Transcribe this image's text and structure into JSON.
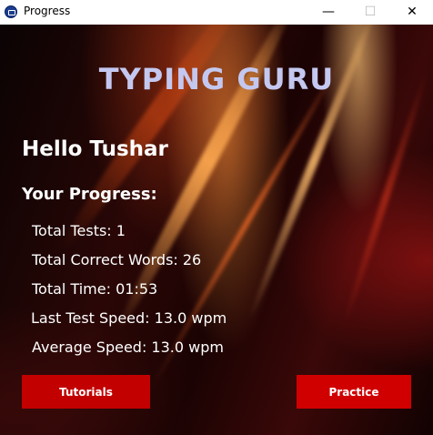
{
  "window": {
    "title": "Progress",
    "controls": {
      "minimize": "—",
      "maximize": "☐",
      "close": "✕"
    }
  },
  "app": {
    "heading": "TYPING GURU",
    "greeting": "Hello Tushar",
    "section_label": "Your Progress:"
  },
  "stats": [
    {
      "text": "Total Tests: 1"
    },
    {
      "text": "Total Correct Words: 26"
    },
    {
      "text": "Total Time: 01:53"
    },
    {
      "text": "Last Test Speed: 13.0 wpm"
    },
    {
      "text": "Average Speed: 13.0 wpm"
    }
  ],
  "buttons": {
    "tutorials": "Tutorials",
    "practice": "Practice"
  },
  "icons": {
    "app_icon": "keyboard-app-icon"
  },
  "colors": {
    "heading": "#c4c8f0",
    "button": "#c20000",
    "text": "#ffffff"
  }
}
